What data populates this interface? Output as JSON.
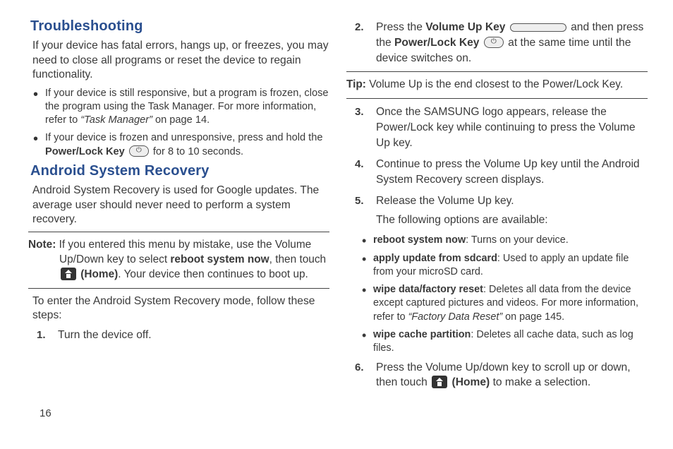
{
  "page_number": "16",
  "left": {
    "h_troubleshooting": "Troubleshooting",
    "trbl_intro": "If your device has fatal errors, hangs up, or freezes, you may need to close all programs or reset the device to regain functionality.",
    "trbl_b1_a": "If your device is still responsive, but a program is frozen, close the program using the Task Manager. For more information, refer to ",
    "trbl_b1_ref": "“Task Manager”",
    "trbl_b1_b": " on page 14.",
    "trbl_b2_a": "If your device is frozen and unresponsive, press and hold the ",
    "trbl_b2_power": "Power/Lock Key",
    "trbl_b2_b": " for 8 to 10 seconds.",
    "h_recovery": "Android System Recovery",
    "rec_intro": "Android System Recovery is used for Google updates. The average user should never need to perform a system recovery.",
    "note_label": "Note:",
    "note_a": " If you entered this menu by mistake, use the Volume Up/Down key to select ",
    "note_reboot": "reboot system now",
    "note_b": ", then touch ",
    "note_home": "(Home)",
    "note_c": ". Your device then continues to boot up.",
    "rec_enter": "To enter the Android System Recovery mode, follow these steps:",
    "step1": "Turn the device off."
  },
  "right": {
    "step2_a": "Press the ",
    "step2_volup": "Volume Up Key",
    "step2_b": " and then press the ",
    "step2_power": "Power/Lock Key",
    "step2_c": " at the same time until the device switches on.",
    "tip_label": "Tip:",
    "tip_text": " Volume Up is the end closest to the Power/Lock Key.",
    "step3": "Once the SAMSUNG logo appears, release the Power/Lock key while continuing to press the Volume Up key.",
    "step4": "Continue to press the Volume Up key until the Android System Recovery screen displays.",
    "step5_a": "Release the Volume Up key.",
    "step5_b": "The following options are available:",
    "opt1_b": "reboot system now",
    "opt1_t": ": Turns on your device.",
    "opt2_b": "apply update from sdcard",
    "opt2_t": ": Used to apply an update file from your microSD card.",
    "opt3_b": "wipe data/factory reset",
    "opt3_t1": ": Deletes all data from the device except captured pictures and videos. For more information, refer to ",
    "opt3_ref": "“Factory Data Reset”",
    "opt3_t2": " on page 145.",
    "opt4_b": "wipe cache partition",
    "opt4_t": ": Deletes all cache data, such as log files.",
    "step6_a": "Press the Volume Up/down key to scroll up or down, then touch ",
    "step6_home": "(Home)",
    "step6_b": " to make a selection."
  }
}
